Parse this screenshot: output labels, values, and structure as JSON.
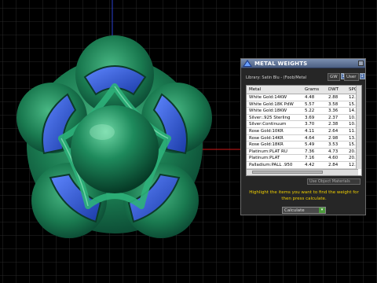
{
  "panel": {
    "title": "METAL WEIGHTS",
    "library_line": "Library: Satin Blu - (Foob/Metal",
    "unit_gw_label": "GW",
    "unit_user_label": "User",
    "unit_gw_checked": "1",
    "unit_user_checked": "1",
    "columns": [
      "Metal",
      "Grams",
      "DWT",
      "SPG"
    ],
    "rows": [
      [
        "White Gold:14KW",
        "4.48",
        "2.88",
        "12.59"
      ],
      [
        "White Gold:18K PdW",
        "5.57",
        "3.58",
        "15.65"
      ],
      [
        "White Gold:18KW",
        "5.22",
        "3.36",
        "14.66"
      ],
      [
        "Silver:.925 Sterling",
        "3.69",
        "2.37",
        "10.36"
      ],
      [
        "Silver:Continuum",
        "3.70",
        "2.38",
        "10.40"
      ],
      [
        "Rose Gold:10KR",
        "4.11",
        "2.64",
        "11.54"
      ],
      [
        "Rose Gold:14KR",
        "4.64",
        "2.98",
        "13.03"
      ],
      [
        "Rose Gold:18KR",
        "5.49",
        "3.53",
        "15.42"
      ],
      [
        "Platinum:PLAT RU",
        "7.36",
        "4.73",
        "20.66"
      ],
      [
        "Platinum:PLAT",
        "7.16",
        "4.60",
        "20.10"
      ],
      [
        "Palladium:PALL .950",
        "4.42",
        "2.84",
        "12.40"
      ]
    ],
    "use_object_materials": "Use Object Materials",
    "instructions": "Highlight the items you want to find the weight for then press calculate.",
    "calculate_label": "Calculate",
    "colors": {
      "instruction_text": "#f0d000",
      "titlebar": "#5b6e93"
    }
  },
  "viewport": {
    "background": "#000000",
    "grid_color": "#2e2e2e",
    "axis_x_color": "#d01818",
    "axis_y_color": "#2a3fd0",
    "model_green": "#1f8a5a",
    "model_blue": "#2e55c8"
  }
}
